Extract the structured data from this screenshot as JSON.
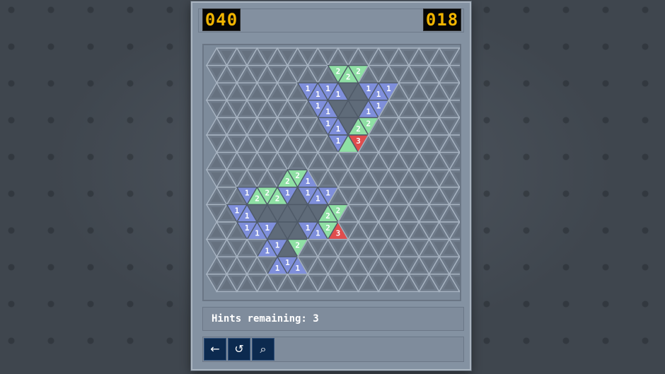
{
  "counters": {
    "left": "040",
    "right": "018"
  },
  "hints": {
    "label": "Hints remaining: 3"
  },
  "toolbar": {
    "buttons": [
      {
        "name": "back-button",
        "icon": "arrow-left-icon",
        "glyph": "←"
      },
      {
        "name": "reset-button",
        "icon": "undo-icon",
        "glyph": "↺"
      },
      {
        "name": "search-button",
        "icon": "magnifier-icon",
        "glyph": "⌕"
      }
    ]
  },
  "colors": {
    "blue": "#7f8fdb",
    "green": "#8fe0a4",
    "red": "#e04d4d",
    "dark": "#5f6b79",
    "cell": "#6f7b8a",
    "counter_text": "#f0b400"
  },
  "grid": {
    "rows": 14,
    "cols": 25
  },
  "cells": [
    {
      "r": 1,
      "c": 12,
      "t": "green",
      "v": "2"
    },
    {
      "r": 1,
      "c": 13,
      "t": "green",
      "v": "2"
    },
    {
      "r": 1,
      "c": 14,
      "t": "green",
      "v": "2"
    },
    {
      "r": 2,
      "c": 9,
      "t": "blue",
      "v": "1"
    },
    {
      "r": 2,
      "c": 10,
      "t": "blue",
      "v": "1"
    },
    {
      "r": 2,
      "c": 11,
      "t": "blue",
      "v": "1"
    },
    {
      "r": 2,
      "c": 12,
      "t": "blue",
      "v": "1"
    },
    {
      "r": 2,
      "c": 13,
      "t": "dark",
      "v": ""
    },
    {
      "r": 2,
      "c": 14,
      "t": "dark",
      "v": ""
    },
    {
      "r": 2,
      "c": 15,
      "t": "blue",
      "v": "1"
    },
    {
      "r": 2,
      "c": 16,
      "t": "blue",
      "v": "1"
    },
    {
      "r": 2,
      "c": 17,
      "t": "blue",
      "v": "1"
    },
    {
      "r": 3,
      "c": 10,
      "t": "blue",
      "v": "1"
    },
    {
      "r": 3,
      "c": 11,
      "t": "blue",
      "v": "1"
    },
    {
      "r": 3,
      "c": 12,
      "t": "dark",
      "v": ""
    },
    {
      "r": 3,
      "c": 13,
      "t": "dark",
      "v": ""
    },
    {
      "r": 3,
      "c": 14,
      "t": "dark",
      "v": ""
    },
    {
      "r": 3,
      "c": 15,
      "t": "blue",
      "v": "1"
    },
    {
      "r": 3,
      "c": 16,
      "t": "blue",
      "v": "1"
    },
    {
      "r": 4,
      "c": 11,
      "t": "blue",
      "v": "1"
    },
    {
      "r": 4,
      "c": 12,
      "t": "blue",
      "v": "1"
    },
    {
      "r": 4,
      "c": 13,
      "t": "dark",
      "v": ""
    },
    {
      "r": 4,
      "c": 14,
      "t": "green",
      "v": "2"
    },
    {
      "r": 4,
      "c": 15,
      "t": "green",
      "v": "2"
    },
    {
      "r": 5,
      "c": 12,
      "t": "blue",
      "v": "1"
    },
    {
      "r": 5,
      "c": 13,
      "t": "green",
      "v": ""
    },
    {
      "r": 5,
      "c": 14,
      "t": "red",
      "v": "3"
    },
    {
      "r": 7,
      "c": 7,
      "t": "green",
      "v": "2"
    },
    {
      "r": 7,
      "c": 8,
      "t": "green",
      "v": "2"
    },
    {
      "r": 7,
      "c": 9,
      "t": "blue",
      "v": "1"
    },
    {
      "r": 8,
      "c": 3,
      "t": "blue",
      "v": "1"
    },
    {
      "r": 8,
      "c": 4,
      "t": "green",
      "v": "2"
    },
    {
      "r": 8,
      "c": 5,
      "t": "green",
      "v": "2"
    },
    {
      "r": 8,
      "c": 6,
      "t": "green",
      "v": "2"
    },
    {
      "r": 8,
      "c": 7,
      "t": "blue",
      "v": "1"
    },
    {
      "r": 8,
      "c": 8,
      "t": "dark",
      "v": ""
    },
    {
      "r": 8,
      "c": 9,
      "t": "blue",
      "v": "1"
    },
    {
      "r": 8,
      "c": 10,
      "t": "blue",
      "v": "1"
    },
    {
      "r": 8,
      "c": 11,
      "t": "blue",
      "v": "1"
    },
    {
      "r": 9,
      "c": 2,
      "t": "blue",
      "v": "1"
    },
    {
      "r": 9,
      "c": 3,
      "t": "blue",
      "v": "1"
    },
    {
      "r": 9,
      "c": 4,
      "t": "dark",
      "v": ""
    },
    {
      "r": 9,
      "c": 5,
      "t": "dark",
      "v": ""
    },
    {
      "r": 9,
      "c": 6,
      "t": "dark",
      "v": ""
    },
    {
      "r": 9,
      "c": 7,
      "t": "dark",
      "v": ""
    },
    {
      "r": 9,
      "c": 8,
      "t": "dark",
      "v": ""
    },
    {
      "r": 9,
      "c": 9,
      "t": "dark",
      "v": ""
    },
    {
      "r": 9,
      "c": 10,
      "t": "dark",
      "v": ""
    },
    {
      "r": 9,
      "c": 11,
      "t": "green",
      "v": "2"
    },
    {
      "r": 9,
      "c": 12,
      "t": "green",
      "v": "2"
    },
    {
      "r": 10,
      "c": 3,
      "t": "blue",
      "v": "1"
    },
    {
      "r": 10,
      "c": 4,
      "t": "blue",
      "v": "1"
    },
    {
      "r": 10,
      "c": 5,
      "t": "blue",
      "v": "1"
    },
    {
      "r": 10,
      "c": 6,
      "t": "dark",
      "v": ""
    },
    {
      "r": 10,
      "c": 7,
      "t": "dark",
      "v": ""
    },
    {
      "r": 10,
      "c": 8,
      "t": "dark",
      "v": ""
    },
    {
      "r": 10,
      "c": 9,
      "t": "blue",
      "v": "1"
    },
    {
      "r": 10,
      "c": 10,
      "t": "blue",
      "v": "1"
    },
    {
      "r": 10,
      "c": 11,
      "t": "green",
      "v": "2"
    },
    {
      "r": 10,
      "c": 12,
      "t": "red",
      "v": "3"
    },
    {
      "r": 11,
      "c": 5,
      "t": "blue",
      "v": "1"
    },
    {
      "r": 11,
      "c": 6,
      "t": "blue",
      "v": "1"
    },
    {
      "r": 11,
      "c": 7,
      "t": "dark",
      "v": ""
    },
    {
      "r": 11,
      "c": 8,
      "t": "green",
      "v": "2"
    },
    {
      "r": 12,
      "c": 6,
      "t": "blue",
      "v": "1"
    },
    {
      "r": 12,
      "c": 7,
      "t": "blue",
      "v": "1"
    },
    {
      "r": 12,
      "c": 8,
      "t": "blue",
      "v": "1"
    }
  ]
}
